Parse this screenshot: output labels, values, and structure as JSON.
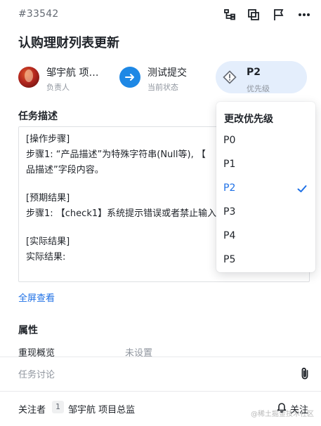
{
  "header": {
    "task_id": "#33542",
    "icons": [
      "subtask-icon",
      "copy-icon",
      "flag-icon",
      "more-icon"
    ]
  },
  "task": {
    "title": "认购理财列表更新"
  },
  "meta": {
    "assignee": {
      "name": "邹宇航 项…",
      "role": "负责人"
    },
    "status": {
      "value": "测试提交",
      "label": "当前状态",
      "color": "#1e88e5"
    },
    "priority": {
      "value": "P2",
      "label": "优先级"
    }
  },
  "description": {
    "heading": "任务描述",
    "lines": [
      "[操作步骤]",
      "步骤1: “产品描述”为特殊字符串(Null等), 【",
      "品描述”字段内容。",
      "",
      "[预期结果]",
      "步骤1: 【check1】系统提示错误或者禁止输入",
      "",
      "[实际结果]",
      "实际结果:"
    ],
    "fullscreen_link": "全屏查看"
  },
  "properties": {
    "heading": "属性",
    "rows": [
      {
        "label": "重现概览",
        "value": "未设置"
      }
    ]
  },
  "discussion": {
    "placeholder": "任务讨论"
  },
  "footer": {
    "followers_label": "关注者",
    "follower_count": "1",
    "follower_name": "邹宇航 项目总监",
    "follow_button": "关注",
    "watermark": "@稀土掘金技术社区"
  },
  "priority_dropdown": {
    "title": "更改优先级",
    "options": [
      "P0",
      "P1",
      "P2",
      "P3",
      "P4",
      "P5"
    ],
    "selected": "P2"
  },
  "colors": {
    "accent": "#1e70e6",
    "status_blue": "#1e88e5",
    "priority_pill": "#e4eefc"
  }
}
